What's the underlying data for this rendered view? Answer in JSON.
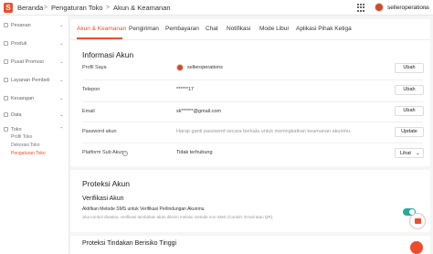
{
  "header": {
    "logo_glyph": "S",
    "breadcrumbs": [
      "Beranda",
      "Pengaturan Toko",
      "Akun & Keamanan"
    ],
    "separator": ">",
    "username": "selleroperations"
  },
  "sidebar": {
    "items": [
      {
        "label": "Pesanan",
        "icon": "order-icon"
      },
      {
        "label": "Produk",
        "icon": "product-icon"
      },
      {
        "label": "Pusat Promosi",
        "icon": "promotion-icon"
      },
      {
        "label": "Layanan Pembeli",
        "icon": "customer-service-icon"
      },
      {
        "label": "Keuangan",
        "icon": "finance-icon"
      },
      {
        "label": "Data",
        "icon": "data-icon"
      },
      {
        "label": "Toko",
        "icon": "shop-icon"
      }
    ],
    "subitems": [
      "Profil Toko",
      "Dekorasi Toko",
      "Pengaturan Toko"
    ]
  },
  "tabs": [
    "Akun & Keamanan",
    "Pengiriman",
    "Pembayaran",
    "Chat",
    "Notifikasi",
    "Mode Libur",
    "Aplikasi Pihak Ketiga"
  ],
  "account": {
    "title": "Informasi Akun",
    "rows": [
      {
        "label": "Profil Saya",
        "value": "selleroperations",
        "button": "Ubah"
      },
      {
        "label": "Telepon",
        "value": "******17",
        "button": "Ubah"
      },
      {
        "label": "Email",
        "value": "sk******@gmail.com",
        "button": "Ubah"
      },
      {
        "label": "Password akun",
        "value": "Harap ganti password secara berkala untuk meningkatkan keamanan akunmu.",
        "button": "Update"
      },
      {
        "label": "Platform Sub Akun",
        "value": "Tidak terhubung",
        "button": "Lihat"
      }
    ],
    "help_glyph": "?"
  },
  "protection": {
    "title": "Proteksi Akun",
    "subtitle": "Verifikasi Akun",
    "desc": "Aktifkan Metode SMS untuk Verifikasi Perlindungan Akunmu.",
    "note": "Jika tombol diwaktu, verifikasi tambahan akan dikirim melalui metode non-SMS (Contoh: Email atau QR).",
    "toggle_on": true
  },
  "risk": {
    "title": "Proteksi Tindakan Berisiko Tinggi"
  },
  "colors": {
    "brand": "#ee4d2d",
    "toggle": "#26aa99"
  }
}
